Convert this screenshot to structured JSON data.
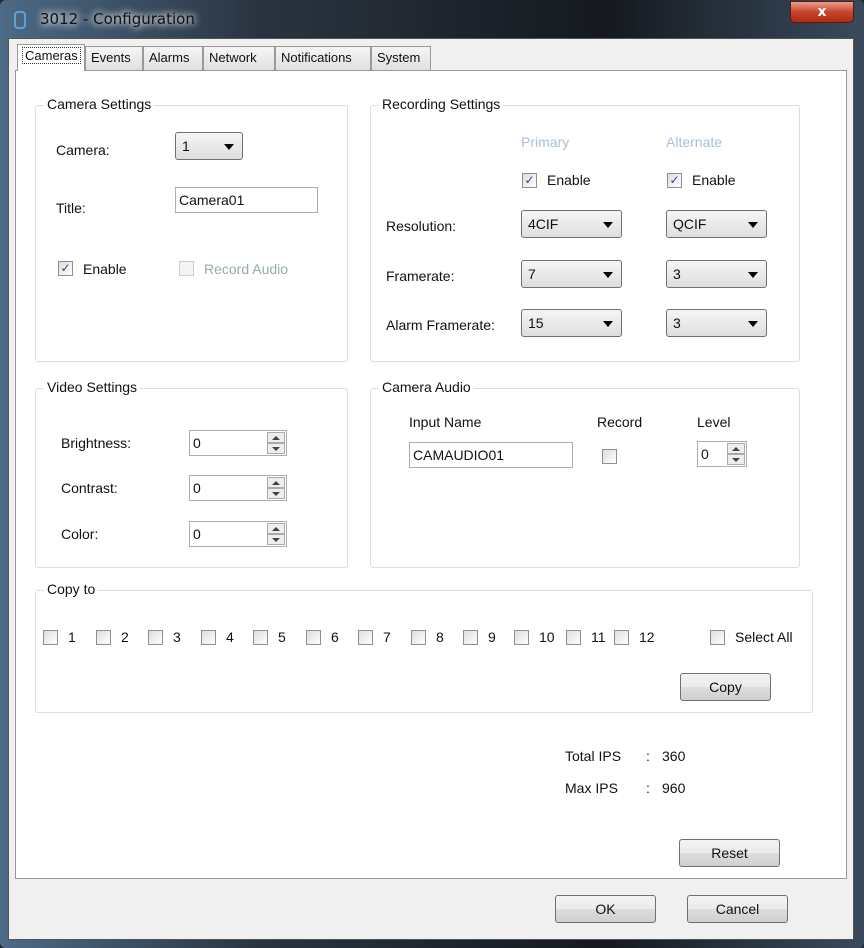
{
  "window": {
    "title": "3012 - Configuration",
    "close": "x"
  },
  "tabs": [
    "Cameras",
    "Events",
    "Alarms",
    "Network",
    "Notifications",
    "System"
  ],
  "camera_settings": {
    "caption": "Camera Settings",
    "camera_label": "Camera:",
    "camera_value": "1",
    "title_label": "Title:",
    "title_value": "Camera01",
    "enable_label": "Enable",
    "enable_checked": true,
    "record_audio_label": "Record Audio",
    "record_audio_checked": false
  },
  "recording_settings": {
    "caption": "Recording Settings",
    "primary": "Primary",
    "alternate": "Alternate",
    "enable_label": "Enable",
    "primary_enabled": true,
    "alternate_enabled": true,
    "resolution_label": "Resolution:",
    "framerate_label": "Framerate:",
    "alarm_framerate_label": "Alarm Framerate:",
    "primary_resolution": "4CIF",
    "alternate_resolution": "QCIF",
    "primary_framerate": "7",
    "alternate_framerate": "3",
    "primary_alarm_framerate": "15",
    "alternate_alarm_framerate": "3"
  },
  "video_settings": {
    "caption": "Video Settings",
    "brightness_label": "Brightness:",
    "brightness": "0",
    "contrast_label": "Contrast:",
    "contrast": "0",
    "color_label": "Color:",
    "color": "0"
  },
  "camera_audio": {
    "caption": "Camera Audio",
    "input_name_label": "Input Name",
    "input_name": "CAMAUDIO01",
    "record_label": "Record",
    "record_checked": false,
    "level_label": "Level",
    "level": "0"
  },
  "copy_to": {
    "caption": "Copy to",
    "cameras": [
      "1",
      "2",
      "3",
      "4",
      "5",
      "6",
      "7",
      "8",
      "9",
      "10",
      "11",
      "12"
    ],
    "select_all": "Select All",
    "copy_button": "Copy"
  },
  "ips": {
    "total_label": "Total IPS",
    "total_value": "360",
    "max_label": "Max IPS",
    "max_value": "960",
    "sep": ":"
  },
  "buttons": {
    "reset": "Reset",
    "ok": "OK",
    "cancel": "Cancel"
  }
}
